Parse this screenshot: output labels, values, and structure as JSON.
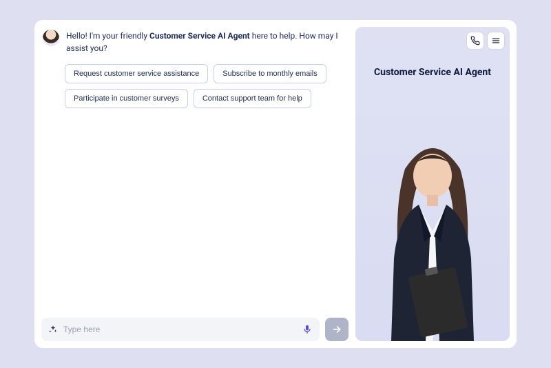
{
  "greeting": {
    "pre": "Hello! I'm your friendly ",
    "bold": "Customer Service AI Agent",
    "post": " here to help. How may I assist you?"
  },
  "chips": [
    "Request customer service assistance",
    "Subscribe to monthly emails",
    "Participate in customer surveys",
    "Contact support team for help"
  ],
  "input": {
    "placeholder": "Type here"
  },
  "side": {
    "title": "Customer Service AI Agent"
  }
}
